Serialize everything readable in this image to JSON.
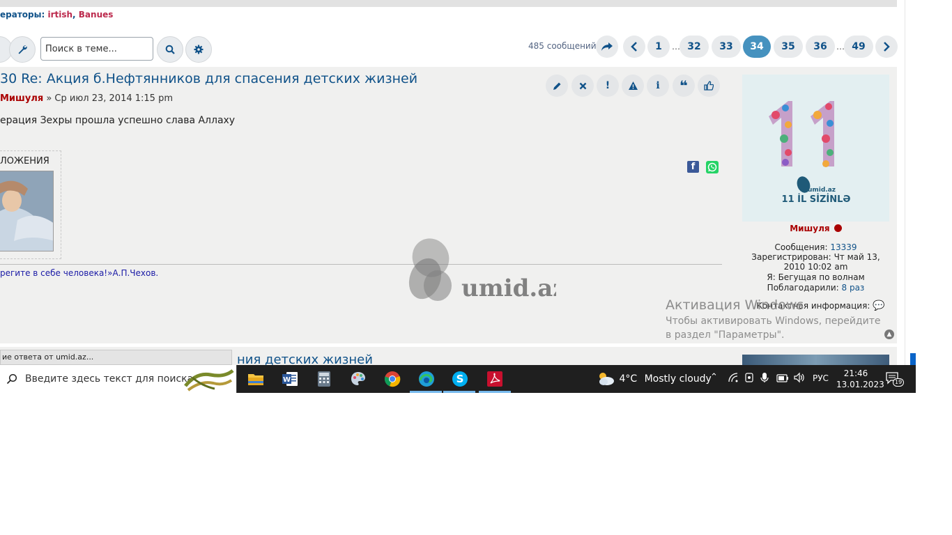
{
  "header": {
    "moderators_label": "ераторы:",
    "moderators": [
      "irtish",
      "Banues"
    ]
  },
  "toolbar": {
    "search_placeholder": "Поиск в теме...",
    "post_count": "485 сообщений"
  },
  "pagination": {
    "pages": [
      "1",
      "32",
      "33",
      "34",
      "35",
      "36",
      "49"
    ],
    "active": "34",
    "ellipsis": "…"
  },
  "post": {
    "title": "30 Re: Акция б.Нефтянников для спасения детских жизней",
    "meta_prefix": "» Ср июл 23, 2014 1:15 pm",
    "author": "Мишуля",
    "text": "ерация Зехры прошла успешно слава Аллаху",
    "attachments_label": "ЛОЖЕНИЯ",
    "signature": "регите в себе человека!»А.П.Чехов."
  },
  "profile": {
    "avatar_brand": "umid.az",
    "avatar_slogan": "11 İL SİZİNLƏ",
    "name": "Мишуля",
    "messages_label": "Сообщения:",
    "messages_value": "13339",
    "registered_label": "Зарегистрирован:",
    "registered_value": "Чт май 13, 2010 10:02 am",
    "ya_label": "Я:",
    "ya_value": "Бегущая по волнам",
    "thanked_label": "Поблагодарили:",
    "thanked_value": "8 раз",
    "contact_label": "Контактная информация:"
  },
  "watermark": {
    "brand": "umid.az"
  },
  "activation": {
    "title": "Активация Windows",
    "subtitle": "Чтобы активировать Windows, перейдите в раздел \"Параметры\"."
  },
  "next_post": {
    "title": "ния детских жизней"
  },
  "status_bar": {
    "text": "ие ответа от umid.az..."
  },
  "taskbar": {
    "search_placeholder": "Введите здесь текст для поиска",
    "weather_temp": "4°C",
    "weather_desc": "Mostly cloudy",
    "lang": "РУС",
    "time": "21:46",
    "date": "13.01.2023",
    "notifications": "19"
  },
  "colors": {
    "link": "#105289",
    "author": "#aa0000",
    "active_page": "#4692bf"
  }
}
